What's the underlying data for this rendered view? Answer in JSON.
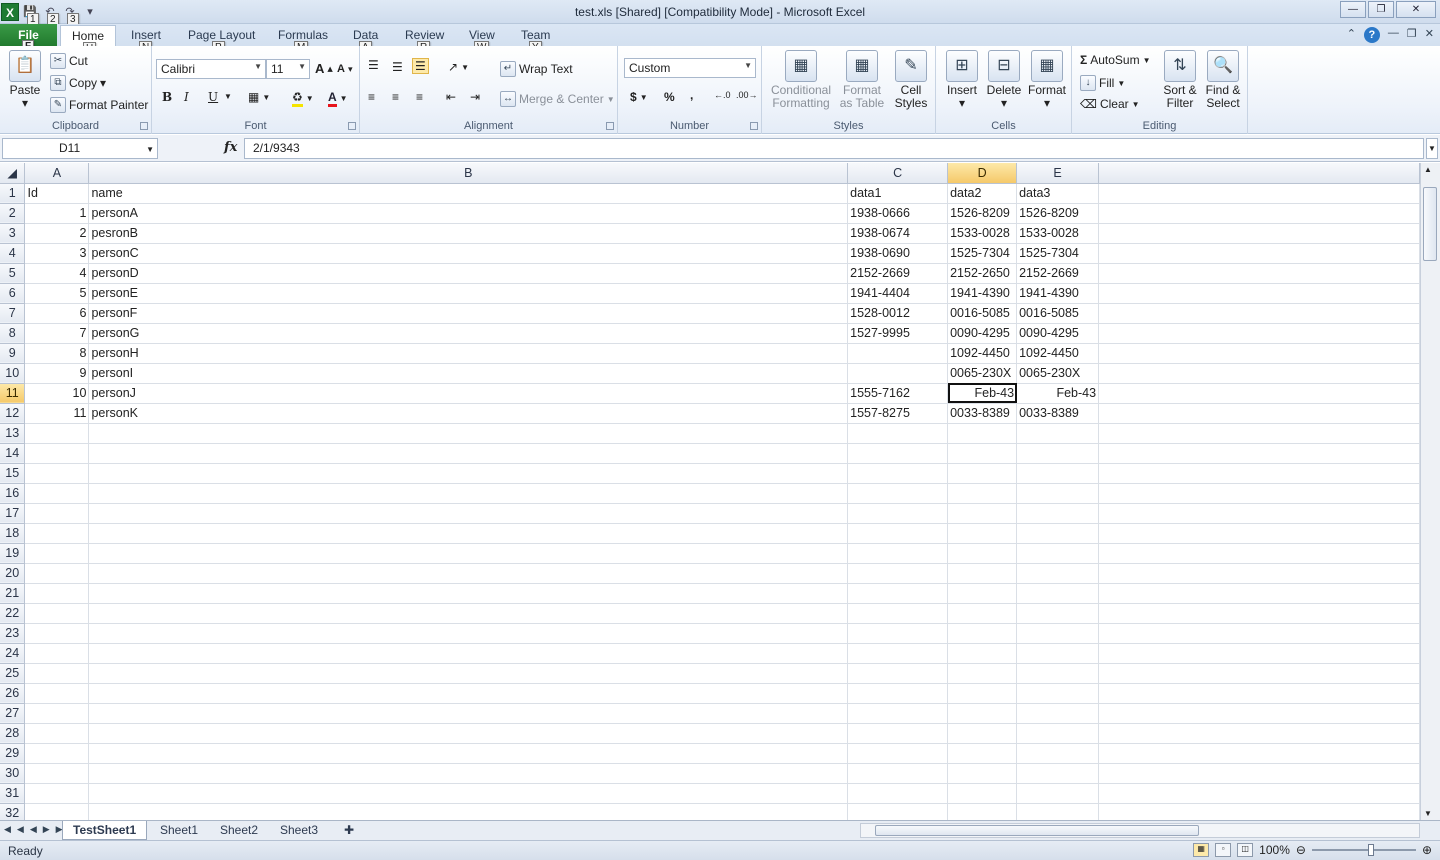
{
  "window": {
    "title": "test.xls  [Shared]  [Compatibility Mode]  -  Microsoft Excel",
    "qat_keytips": [
      "1",
      "2",
      "3"
    ]
  },
  "tabs": {
    "items": [
      {
        "label": "File",
        "keytip": "F"
      },
      {
        "label": "Home",
        "keytip": "H"
      },
      {
        "label": "Insert",
        "keytip": "N"
      },
      {
        "label": "Page Layout",
        "keytip": "P"
      },
      {
        "label": "Formulas",
        "keytip": "M"
      },
      {
        "label": "Data",
        "keytip": "A"
      },
      {
        "label": "Review",
        "keytip": "R"
      },
      {
        "label": "View",
        "keytip": "W"
      },
      {
        "label": "Team",
        "keytip": "Y"
      }
    ]
  },
  "ribbon": {
    "clipboard": {
      "label": "Clipboard",
      "paste": "Paste",
      "cut": "Cut",
      "copy": "Copy",
      "format_painter": "Format Painter"
    },
    "font": {
      "label": "Font",
      "name": "Calibri",
      "size": "11",
      "bold": "B",
      "italic": "I",
      "underline": "U"
    },
    "alignment": {
      "label": "Alignment",
      "wrap_text": "Wrap Text",
      "merge_center": "Merge & Center"
    },
    "number": {
      "label": "Number",
      "format": "Custom",
      "currency": "$",
      "percent": "%",
      "comma": ","
    },
    "styles": {
      "label": "Styles",
      "conditional": "Conditional Formatting",
      "format_table": "Format as Table",
      "cell_styles": "Cell Styles"
    },
    "cells": {
      "label": "Cells",
      "insert": "Insert",
      "delete": "Delete",
      "format": "Format"
    },
    "editing": {
      "label": "Editing",
      "autosum": "AutoSum",
      "fill": "Fill",
      "clear": "Clear",
      "sort_filter": "Sort & Filter",
      "find_select": "Find & Select"
    }
  },
  "formula_bar": {
    "name_box": "D11",
    "fx": "fx",
    "value": "2/1/9343"
  },
  "grid": {
    "columns": [
      "A",
      "B",
      "C",
      "D",
      "E"
    ],
    "selected_column": "D",
    "selected_row": 11,
    "active_cell": "D11",
    "rows": [
      {
        "n": 1,
        "cells": [
          "Id",
          "name",
          "data1",
          "data2",
          "data3"
        ]
      },
      {
        "n": 2,
        "cells": [
          "1",
          "personA",
          "1938-0666",
          "1526-8209",
          "1526-8209"
        ]
      },
      {
        "n": 3,
        "cells": [
          "2",
          "pesronB",
          "1938-0674",
          "1533-0028",
          "1533-0028"
        ]
      },
      {
        "n": 4,
        "cells": [
          "3",
          "personC",
          "1938-0690",
          "1525-7304",
          "1525-7304"
        ]
      },
      {
        "n": 5,
        "cells": [
          "4",
          "personD",
          "2152-2669",
          "2152-2650",
          "2152-2669"
        ]
      },
      {
        "n": 6,
        "cells": [
          "5",
          "personE",
          "1941-4404",
          "1941-4390",
          "1941-4390"
        ]
      },
      {
        "n": 7,
        "cells": [
          "6",
          "personF",
          "1528-0012",
          "0016-5085",
          "0016-5085"
        ]
      },
      {
        "n": 8,
        "cells": [
          "7",
          "personG",
          "1527-9995",
          "0090-4295",
          "0090-4295"
        ]
      },
      {
        "n": 9,
        "cells": [
          "8",
          "personH",
          "",
          "1092-4450",
          "1092-4450"
        ]
      },
      {
        "n": 10,
        "cells": [
          "9",
          "personI",
          "",
          "0065-230X",
          "0065-230X"
        ]
      },
      {
        "n": 11,
        "cells": [
          "10",
          "personJ",
          "1555-7162",
          "Feb-43",
          "Feb-43"
        ]
      },
      {
        "n": 12,
        "cells": [
          "11",
          "personK",
          "1557-8275",
          "0033-8389",
          "0033-8389"
        ]
      }
    ],
    "empty_rows": [
      13,
      14,
      15,
      16,
      17,
      18,
      19,
      20,
      21,
      22,
      23,
      24,
      25,
      26,
      27,
      28,
      29,
      30,
      31,
      32
    ]
  },
  "sheets": {
    "tabs": [
      "TestSheet1",
      "Sheet1",
      "Sheet2",
      "Sheet3"
    ],
    "active": "TestSheet1"
  },
  "status": {
    "mode": "Ready",
    "zoom": "100%"
  }
}
